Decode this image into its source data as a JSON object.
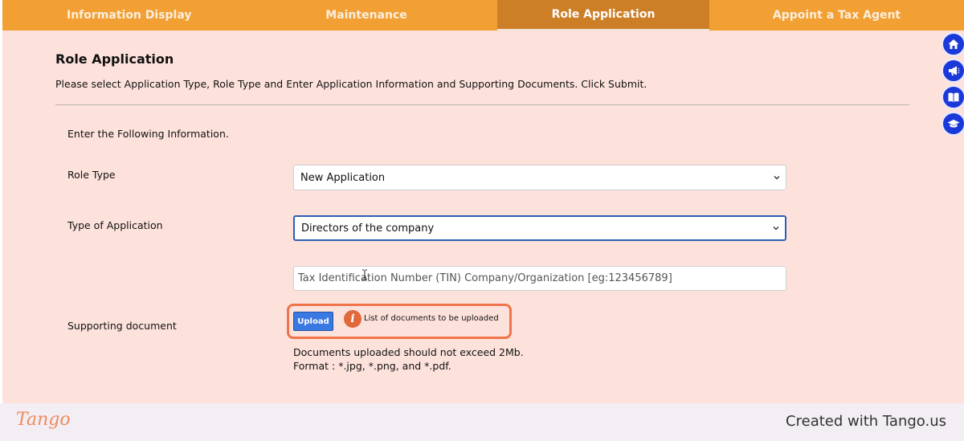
{
  "tabs": [
    {
      "label": "Information Display",
      "active": false
    },
    {
      "label": "Maintenance",
      "active": false
    },
    {
      "label": "Role Application",
      "active": true
    },
    {
      "label": "Appoint a Tax Agent",
      "active": false
    }
  ],
  "page": {
    "title": "Role Application",
    "instruction": "Please select Application Type, Role Type and Enter Application Information and Supporting Documents. Click Submit.",
    "section_intro": "Enter the Following Information."
  },
  "form": {
    "role_type": {
      "label": "Role Type",
      "value": "New Application"
    },
    "application_type": {
      "label": "Type of Application",
      "value": "Directors of the company"
    },
    "tin": {
      "placeholder": "Tax Identification Number (TIN) Company/Organization [eg:123456789]",
      "value": ""
    },
    "supporting_document": {
      "label": "Supporting document",
      "upload_label": "Upload",
      "info_text": "List of documents to be uploaded",
      "info_icon": "info-icon",
      "note_line1": "Documents uploaded should not exceed 2Mb.",
      "note_line2": "Format : *.jpg, *.png, and *.pdf."
    }
  },
  "side_icons": [
    "home-icon",
    "megaphone-icon",
    "book-icon",
    "graduation-cap-icon"
  ],
  "footer": {
    "logo": "Tango",
    "created_with": "Created with Tango.us"
  },
  "colors": {
    "tab_bar": "#f2a034",
    "active_tab": "#cd7f28",
    "panel_bg": "#fde2dc",
    "upload_button": "#3a78e2",
    "highlight": "#f0744a",
    "side_icon": "#1b39d9"
  }
}
